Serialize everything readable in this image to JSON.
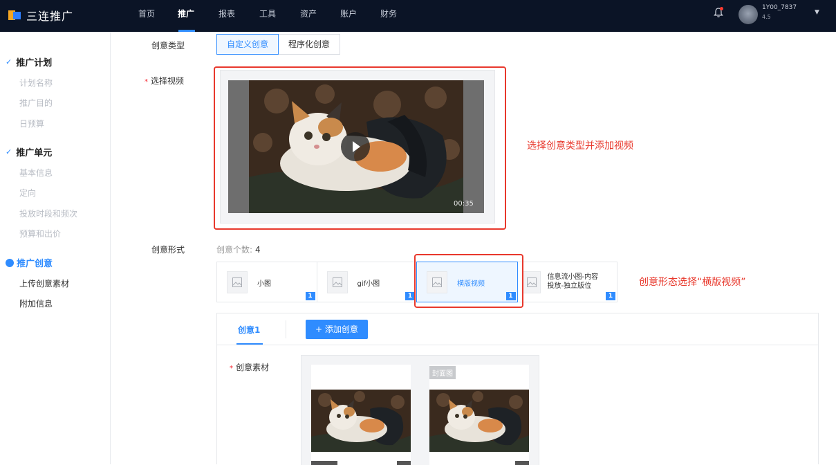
{
  "app": {
    "name": "三连推广"
  },
  "nav": [
    "首页",
    "推广",
    "报表",
    "工具",
    "资产",
    "账户",
    "财务"
  ],
  "nav_active": "推广",
  "user": {
    "name": "1Y00_7837",
    "sub": "4.5"
  },
  "sidebar": {
    "groups": [
      {
        "title": "推广计划",
        "items": [
          "计划名称",
          "推广目的",
          "日预算"
        ]
      },
      {
        "title": "推广单元",
        "items": [
          "基本信息",
          "定向",
          "投放时段和频次",
          "预算和出价"
        ]
      },
      {
        "title": "推广创意",
        "items": [
          "上传创意素材",
          "附加信息"
        ]
      }
    ]
  },
  "form": {
    "creative_type_label": "创意类型",
    "creative_types": [
      "自定义创意",
      "程序化创意"
    ],
    "select_video_label": "选择视频",
    "video_duration": "00:35",
    "creative_form_label": "创意形式",
    "creative_count_label": "创意个数:",
    "creative_count": "4",
    "forms": [
      {
        "label": "小图",
        "badge": "1"
      },
      {
        "label": "gif小图",
        "badge": "1"
      },
      {
        "label": "横版视频",
        "badge": "1"
      },
      {
        "label_line1": "信息流小图-内容",
        "label_line2": "投放-独立版位",
        "badge": "1"
      }
    ]
  },
  "creative_panel": {
    "tab": "创意1",
    "add_button": "+ 添加创意",
    "material_label": "创意素材",
    "cover_tag": "封面图"
  },
  "annotations": {
    "video": "选择创意类型并添加视频",
    "form": "创意形态选择“横版视频”"
  },
  "colors": {
    "accent": "#2f8cff",
    "annotation": "#e8382c",
    "topbar": "#0b1426"
  }
}
